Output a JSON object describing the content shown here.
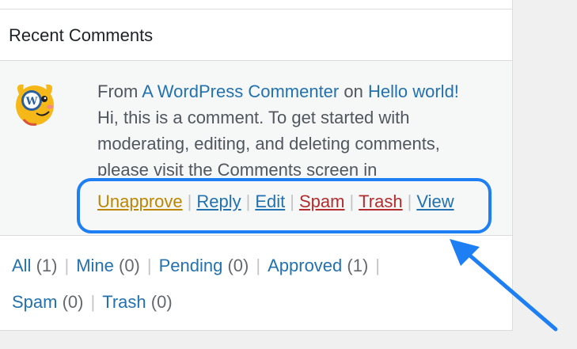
{
  "widget": {
    "title": "Recent Comments"
  },
  "comment": {
    "from_label": "From",
    "author": "A WordPress Commenter",
    "on_label": "on",
    "post": "Hello world!",
    "excerpt": "Hi, this is a comment. To get started with moderating, editing, and deleting comments, please visit the Comments screen in",
    "actions": {
      "unapprove": "Unapprove",
      "reply": "Reply",
      "edit": "Edit",
      "spam": "Spam",
      "trash": "Trash",
      "view": "View"
    },
    "action_separator": "|"
  },
  "filters": [
    {
      "label": "All",
      "count": "(1)"
    },
    {
      "label": "Mine",
      "count": "(0)"
    },
    {
      "label": "Pending",
      "count": "(0)"
    },
    {
      "label": "Approved",
      "count": "(1)"
    },
    {
      "label": "Spam",
      "count": "(0)"
    },
    {
      "label": "Trash",
      "count": "(0)"
    }
  ],
  "filter_separator": "|",
  "colors": {
    "link": "#2271b1",
    "unapprove": "#bd8600",
    "danger": "#b32d2e",
    "highlight": "#1e7ff5"
  },
  "icons": {
    "avatar": "wapuu-avatar",
    "annotation": "arrow-pointer-icon"
  }
}
